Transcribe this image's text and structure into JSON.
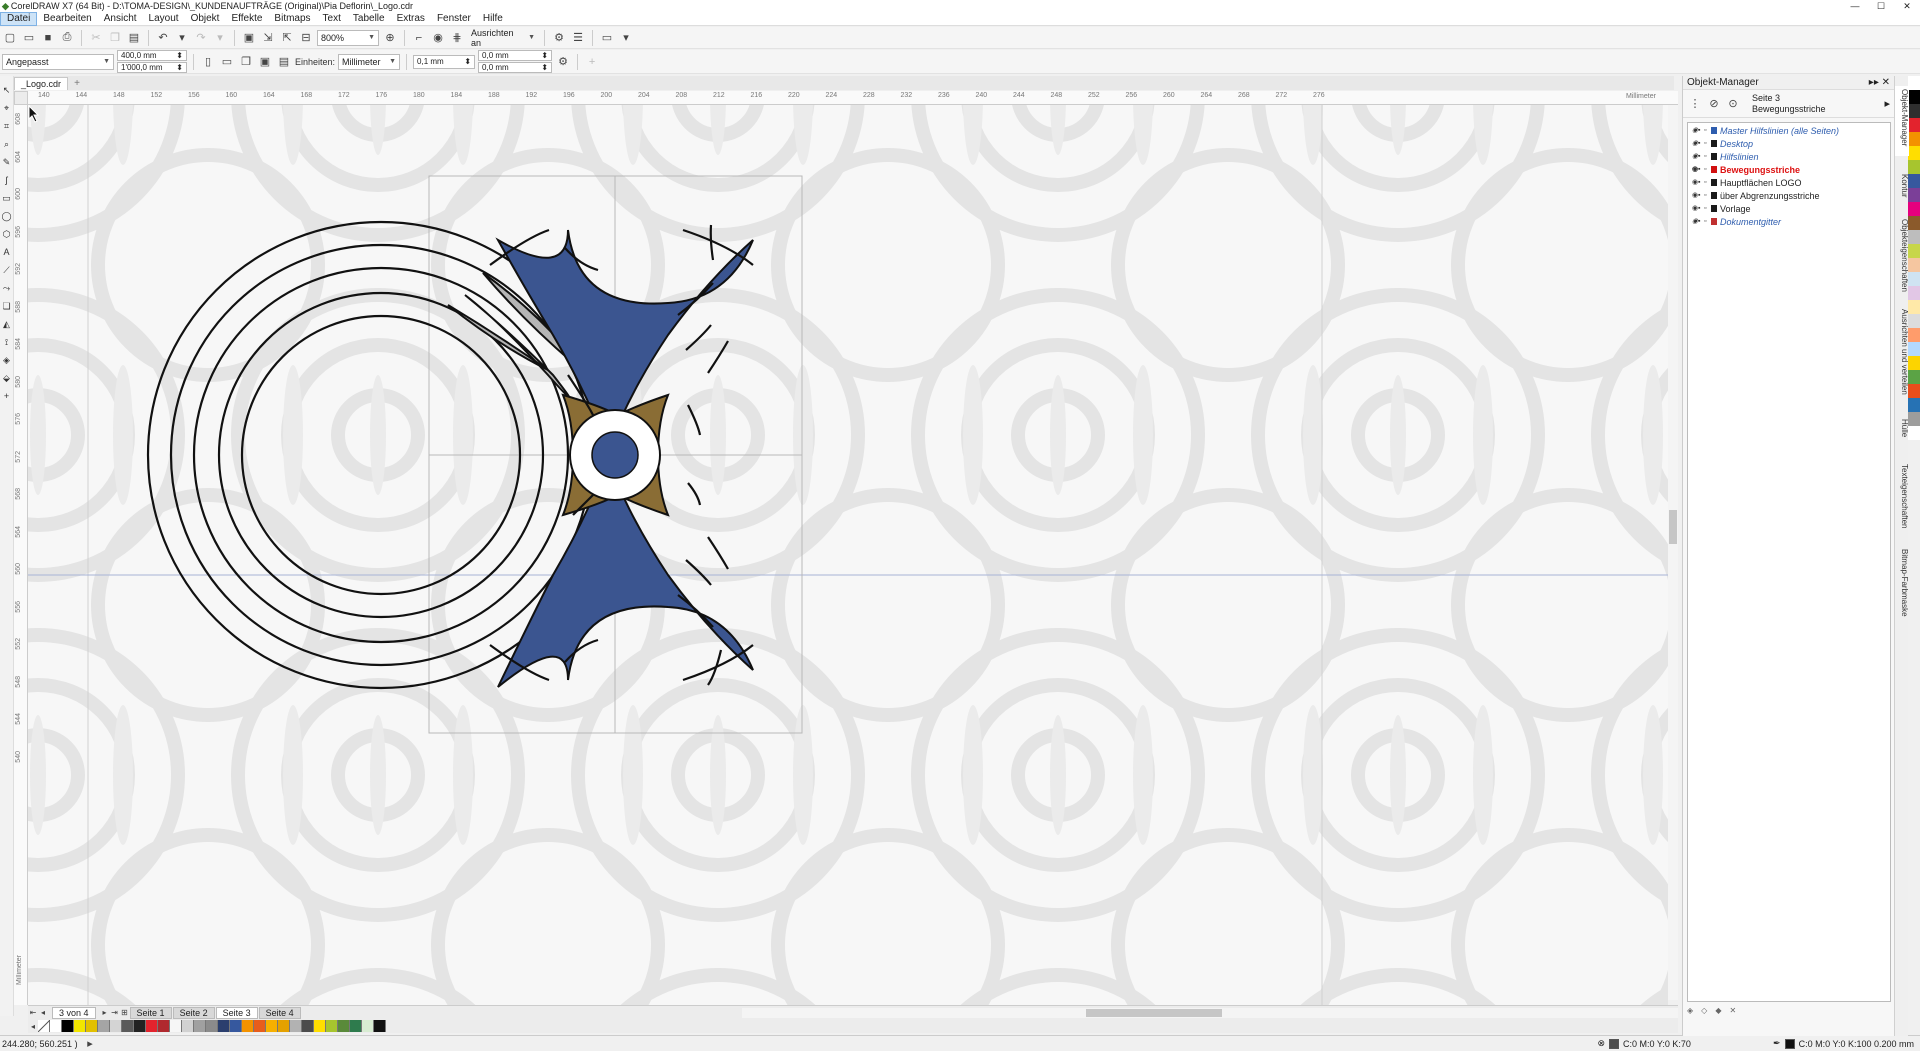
{
  "window": {
    "title": "CorelDRAW X7 (64 Bit) - D:\\TOMA-DESIGN\\_KUNDENAUFTRÄGE (Original)\\Pia Deflorin\\_Logo.cdr",
    "minimize": "—",
    "maximize": "☐",
    "close": "✕"
  },
  "menu": [
    "Datei",
    "Bearbeiten",
    "Ansicht",
    "Layout",
    "Objekt",
    "Effekte",
    "Bitmaps",
    "Text",
    "Tabelle",
    "Extras",
    "Fenster",
    "Hilfe"
  ],
  "toolbar": {
    "zoom": "800%",
    "snap": "Ausrichten an"
  },
  "propbar": {
    "preset": "Angepasst",
    "width": "400,0 mm",
    "height": "1'000,0 mm",
    "units_label": "Einheiten:",
    "units": "Millimeter",
    "nudge": "0,1 mm",
    "dup_x": "0,0 mm",
    "dup_y": "0,0 mm"
  },
  "doc_tab": "_Logo.cdr",
  "ruler": {
    "unit": "Millimeter",
    "h_ticks": [
      "140",
      "144",
      "148",
      "152",
      "156",
      "160",
      "164",
      "168",
      "172",
      "176",
      "180",
      "184",
      "188",
      "192",
      "196",
      "200",
      "204",
      "208",
      "212",
      "216",
      "220",
      "224",
      "228",
      "232",
      "236",
      "240",
      "244",
      "248",
      "252",
      "256",
      "260",
      "264",
      "268",
      "272",
      "276"
    ],
    "v_ticks": [
      "608",
      "604",
      "600",
      "596",
      "592",
      "588",
      "584",
      "580",
      "576",
      "572",
      "568",
      "564",
      "560",
      "556",
      "552",
      "548",
      "544",
      "540"
    ]
  },
  "pages": {
    "counter": "3 von 4",
    "tabs": [
      "Seite 1",
      "Seite 2",
      "Seite 3",
      "Seite 4"
    ],
    "active_index": 2
  },
  "palette": [
    "#ffffff",
    "#000000",
    "#f2e600",
    "#e2c000",
    "#a5a5a5",
    "#d4d4d4",
    "#5a5a5a",
    "#222222",
    "#e3232d",
    "#b0292e",
    "#f6f6f6",
    "#d1d1d1",
    "#a0a0a0",
    "#8b8b8b",
    "#2b3f6e",
    "#36589e",
    "#f39200",
    "#e85d1c",
    "#f7b000",
    "#e4a100",
    "#b2b2b2",
    "#4c4c4c",
    "#ffde00",
    "#a7c52e",
    "#5a8a3a",
    "#2e7b4d",
    "#d8ecd2",
    "#111111"
  ],
  "status": {
    "coords": "244.280; 560.251 )",
    "fill": "C:0 M:0 Y:0 K:70",
    "outline": "C:0 M:0 Y:0 K:100  0.200 mm"
  },
  "object_manager": {
    "title": "Objekt-Manager",
    "page": "Seite 3",
    "layer": "Bewegungsstriche",
    "layers": [
      {
        "name": "Master Hilfslinien (alle Seiten)",
        "style": "italic-blue",
        "color": "#2e5dae"
      },
      {
        "name": "Desktop",
        "style": "italic-blue",
        "color": "#1a1a1a"
      },
      {
        "name": "Hilfslinien",
        "style": "italic-blue",
        "color": "#1a1a1a"
      },
      {
        "name": "Bewegungsstriche",
        "style": "active-red",
        "color": "#d11111"
      },
      {
        "name": "Hauptflächen LOGO",
        "style": "normal",
        "color": "#1a1a1a"
      },
      {
        "name": "über Abgrenzungsstriche",
        "style": "normal",
        "color": "#1a1a1a"
      },
      {
        "name": "Vorlage",
        "style": "normal",
        "color": "#1a1a1a"
      },
      {
        "name": "Dokumentgitter",
        "style": "italic-blue",
        "color": "#c03030"
      }
    ]
  },
  "docker_tabs": [
    "Objekt-Manager",
    "Kontur",
    "Objekteigenschaften",
    "Ausrichten und verteilen",
    "Hülle",
    "Texteigenschaften",
    "Bitmap-Farbmaske"
  ],
  "colors": {
    "blue": "#3b5590",
    "brown": "#8a6d35",
    "grey_fill": "#b5b5b5"
  }
}
